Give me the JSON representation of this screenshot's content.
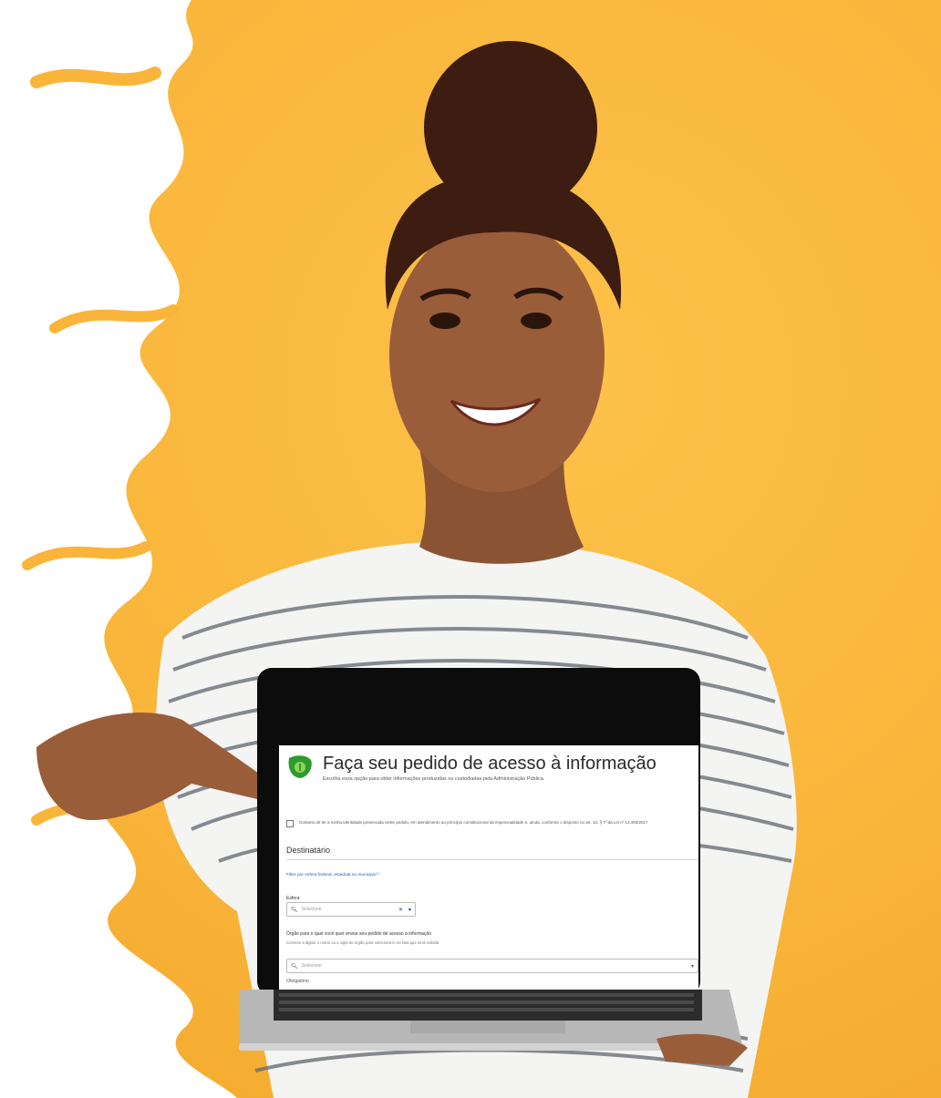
{
  "screen": {
    "title": "Faça seu pedido de acesso à informação",
    "subtitle": "Escolha essa opção para obter informações produzidas ou custodiadas pela Administração Pública.",
    "checkbox_text": "Gostaria de ter a minha identidade preservada neste pedido, em atendimento ao princípio constitucional da impessoalidade e, ainda, conforme o disposto no art. 10, § 7º da Lei nº 13.460/2017",
    "section_title": "Destinatário",
    "filter_link": "Filtre por esfera federal, estadual ou municipal ^",
    "esfera_label": "Esfera",
    "esfera_placeholder": "Selecione",
    "orgao_label": "Órgão para o qual você quer enviar seu pedido de acesso à informação",
    "orgao_hint": "Comece a digitar o nome ou a sigla do órgão para selecioná-lo na lista que será exibida",
    "orgao_placeholder": "Selecione",
    "required_note": "Obrigatório"
  },
  "colors": {
    "background": "#f9b53a",
    "logo_green": "#2e9b2e",
    "link_blue": "#1d5fbf"
  },
  "icons": [
    "search-icon",
    "clear-icon",
    "chevron-down-icon",
    "logo-icon"
  ]
}
